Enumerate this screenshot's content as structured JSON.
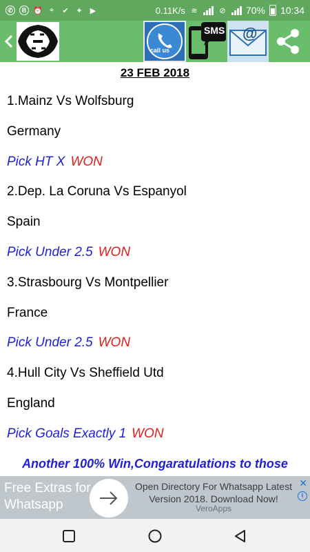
{
  "status_bar": {
    "network_speed": "0.11K/s",
    "battery": "70%",
    "time": "10:34",
    "colors": {
      "background": "#5fa85d"
    },
    "icons": [
      "whatsapp-icon",
      "blackberry-icon",
      "alarm-icon",
      "location-icon",
      "check-icon",
      "twitter-icon",
      "youtube-icon",
      "wifi-icon",
      "mute-icon",
      "signal-icon",
      "battery-icon"
    ]
  },
  "app_bar": {
    "colors": {
      "background": "#6abe6b"
    },
    "callus_label": "call us",
    "sms_label": "SMS",
    "mail_label": "@"
  },
  "content": {
    "date": "23 FEB 2018",
    "matches": [
      {
        "title": "1.Mainz Vs Wolfsburg",
        "country": "Germany",
        "pick": "Pick HT X",
        "result": "WON"
      },
      {
        "title": "2.Dep. La Coruna Vs Espanyol",
        "country": "Spain",
        "pick": "Pick Under 2.5",
        "result": "WON"
      },
      {
        "title": "3.Strasbourg Vs Montpellier",
        "country": "France",
        "pick": "Pick Under 2.5",
        "result": "WON"
      },
      {
        "title": "4.Hull City Vs Sheffield Utd",
        "country": "England",
        "pick": "Pick Goals Exactly 1",
        "result": "WON"
      }
    ],
    "footer": "Another 100% Win,Congaratulations to those"
  },
  "ad": {
    "title": "Free Extras for Whatsapp",
    "body": "Open Directory For Whatsapp Latest Version 2018. Download Now!",
    "sponsor": "VeroApps",
    "close_symbol": "✕",
    "info_symbol": "i"
  },
  "colors": {
    "pick_blue": "#1f1fd8",
    "won_red": "#e0201c"
  }
}
